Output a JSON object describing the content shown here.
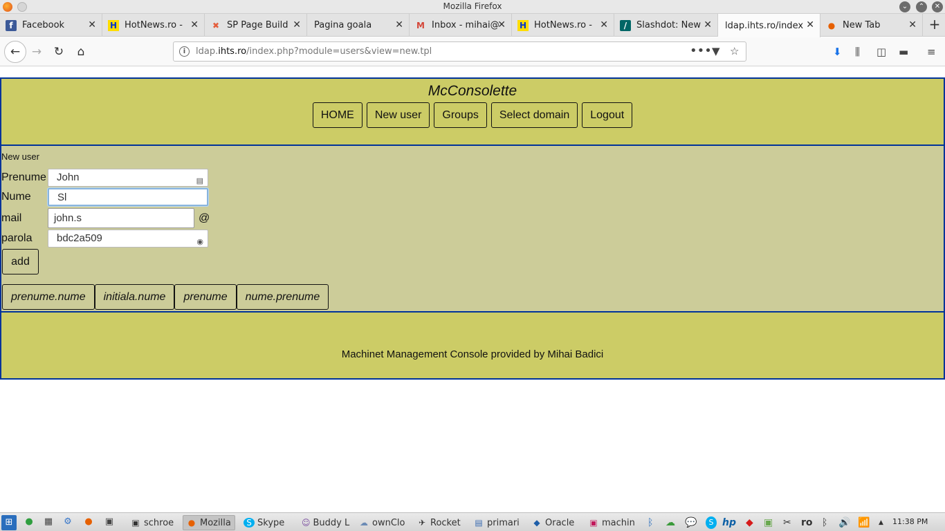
{
  "window": {
    "title": "Mozilla Firefox"
  },
  "tabs": [
    {
      "label": "Facebook",
      "icon": "f",
      "color": "#3b5998"
    },
    {
      "label": "HotNews.ro - ",
      "icon": "H",
      "color": "#0033cc"
    },
    {
      "label": "SP Page Build",
      "icon": "✖",
      "color": "#e45d3c"
    },
    {
      "label": "Pagina goala",
      "icon": "",
      "color": ""
    },
    {
      "label": "Inbox - mihai@",
      "icon": "M",
      "color": "#d44638"
    },
    {
      "label": "HotNews.ro - ",
      "icon": "H",
      "color": "#0033cc"
    },
    {
      "label": "Slashdot: New",
      "icon": "/",
      "color": "#006666"
    },
    {
      "label": "ldap.ihts.ro/index",
      "icon": "",
      "color": ""
    },
    {
      "label": "New Tab",
      "icon": "●",
      "color": "#e66000"
    }
  ],
  "navbar": {
    "url_prefix": "ldap.",
    "url_domain": "ihts.ro",
    "url_path": "/index.php?module=users&view=new.tpl"
  },
  "page": {
    "site_title": "McConsolette",
    "menu": [
      "HOME",
      "New user",
      "Groups",
      "Select domain",
      "Logout"
    ],
    "section_title": "New user",
    "form": {
      "prenume_label": "Prenume",
      "prenume_value": "John",
      "nume_label": "Nume",
      "nume_value": "Sl",
      "mail_label": "mail",
      "mail_value": "john.s",
      "at": "@",
      "parola_label": "parola",
      "parola_value": "bdc2a509"
    },
    "add_label": "add",
    "patterns": [
      "prenume.nume",
      "initiala.nume",
      "prenume",
      "nume.prenume"
    ],
    "footer": "Machinet Management Console provided by Mihai Badici"
  },
  "taskbar": {
    "tasks": [
      {
        "label": "schroe",
        "icon": "▣"
      },
      {
        "label": "Mozilla",
        "icon": "●"
      },
      {
        "label": "Skype",
        "icon": "S"
      },
      {
        "label": "Buddy L",
        "icon": "☺"
      },
      {
        "label": "ownClo",
        "icon": "☁"
      },
      {
        "label": "Rocket",
        "icon": "✈"
      },
      {
        "label": "primari",
        "icon": "▤"
      },
      {
        "label": "Oracle",
        "icon": "◆"
      },
      {
        "label": "machin",
        "icon": "▣"
      }
    ],
    "lang": "ro",
    "clock": "11:38 PM"
  }
}
